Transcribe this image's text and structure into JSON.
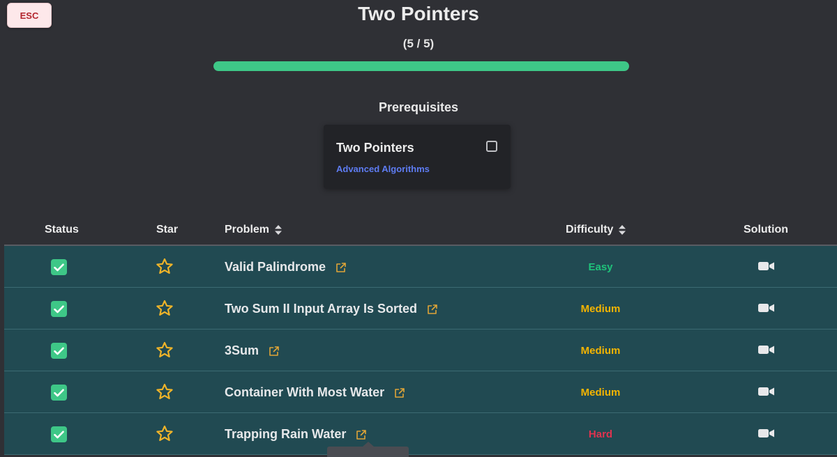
{
  "esc_label": "ESC",
  "title": "Two Pointers",
  "progress": {
    "text": "(5 / 5)",
    "completed": 5,
    "total": 5,
    "color": "#3ec787"
  },
  "prerequisites": {
    "heading": "Prerequisites",
    "items": [
      {
        "title": "Two Pointers",
        "subtitle": "Advanced Algorithms",
        "checked": false
      }
    ]
  },
  "table": {
    "headers": {
      "status": "Status",
      "star": "Star",
      "problem": "Problem",
      "difficulty": "Difficulty",
      "solution": "Solution"
    },
    "rows": [
      {
        "problem": "Valid Palindrome",
        "difficulty": "Easy",
        "completed": true,
        "starred": false
      },
      {
        "problem": "Two Sum II Input Array Is Sorted",
        "difficulty": "Medium",
        "completed": true,
        "starred": false
      },
      {
        "problem": "3Sum",
        "difficulty": "Medium",
        "completed": true,
        "starred": false
      },
      {
        "problem": "Container With Most Water",
        "difficulty": "Medium",
        "completed": true,
        "starred": false
      },
      {
        "problem": "Trapping Rain Water",
        "difficulty": "Hard",
        "completed": true,
        "starred": false
      }
    ]
  },
  "colors": {
    "easy": "#1fc27a",
    "medium": "#f4b400",
    "hard": "#e0334f",
    "star": "#f0b429",
    "link_icon": "#e0a537",
    "row_bg": "#214a52"
  },
  "icons": {
    "status": "check-square-icon",
    "star": "star-outline-icon",
    "external": "external-link-icon",
    "solution": "video-camera-icon",
    "sort": "sort-icon"
  }
}
